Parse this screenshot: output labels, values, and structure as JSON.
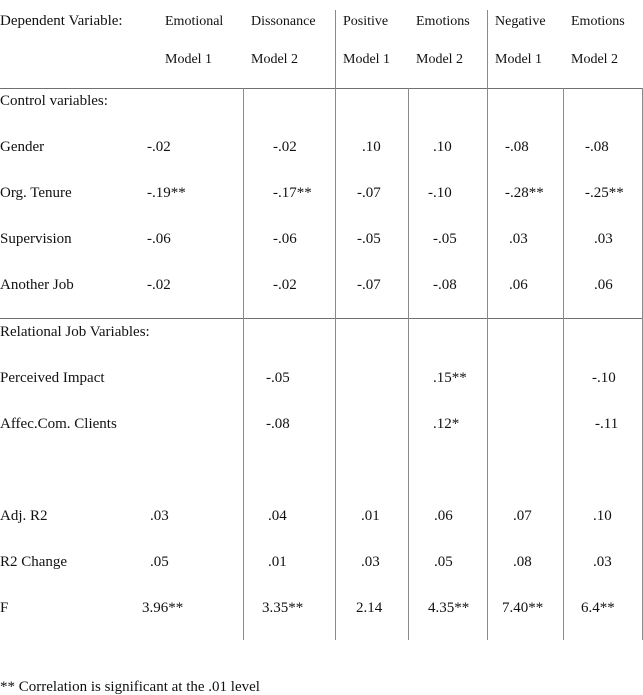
{
  "table": {
    "header": {
      "dependent_variable_label": "Dependent Variable:",
      "groups": [
        {
          "title_left": "Emotional",
          "title_right": "Dissonance",
          "model_left": "Model 1",
          "model_right": "Model 2"
        },
        {
          "title_left": "Positive",
          "title_right": "Emotions",
          "model_left": "Model 1",
          "model_right": "Model 2"
        },
        {
          "title_left": "Negative",
          "title_right": "Emotions",
          "model_left": "Model 1",
          "model_right": "Model 2"
        }
      ]
    },
    "sections": [
      {
        "title": "Control variables:",
        "rows": [
          {
            "label": "Gender",
            "values": [
              "-.02",
              "-.02",
              ".10",
              ".10",
              "-.08",
              "-.08"
            ]
          },
          {
            "label": "Org. Tenure",
            "values": [
              "-.19**",
              "-.17**",
              "-.07",
              "-.10",
              "-.28**",
              "-.25**"
            ]
          },
          {
            "label": "Supervision",
            "values": [
              "-.06",
              "-.06",
              "-.05",
              "-.05",
              ".03",
              ".03"
            ]
          },
          {
            "label": "Another Job",
            "values": [
              "-.02",
              "-.02",
              "-.07",
              "-.08",
              ".06",
              ".06"
            ]
          }
        ]
      },
      {
        "title": "Relational Job Variables:",
        "rows": [
          {
            "label": "Perceived Impact",
            "values": [
              "",
              "-.05",
              "",
              ".15**",
              "",
              "-.10"
            ]
          },
          {
            "label": "Affec.Com. Clients",
            "values": [
              "",
              "-.08",
              "",
              ".12*",
              "",
              "-.11"
            ]
          }
        ]
      }
    ],
    "summary_rows": [
      {
        "label": "Adj. R2",
        "values": [
          ".03",
          ".04",
          ".01",
          ".06",
          ".07",
          ".10"
        ]
      },
      {
        "label": "R2 Change",
        "values": [
          ".05",
          ".01",
          ".03",
          ".05",
          ".08",
          ".03"
        ]
      },
      {
        "label": "F",
        "values": [
          "3.96**",
          "3.35**",
          "2.14",
          "4.35**",
          "7.40**",
          "6.4**"
        ]
      }
    ],
    "footnote": "** Correlation is significant at the .01 level"
  }
}
